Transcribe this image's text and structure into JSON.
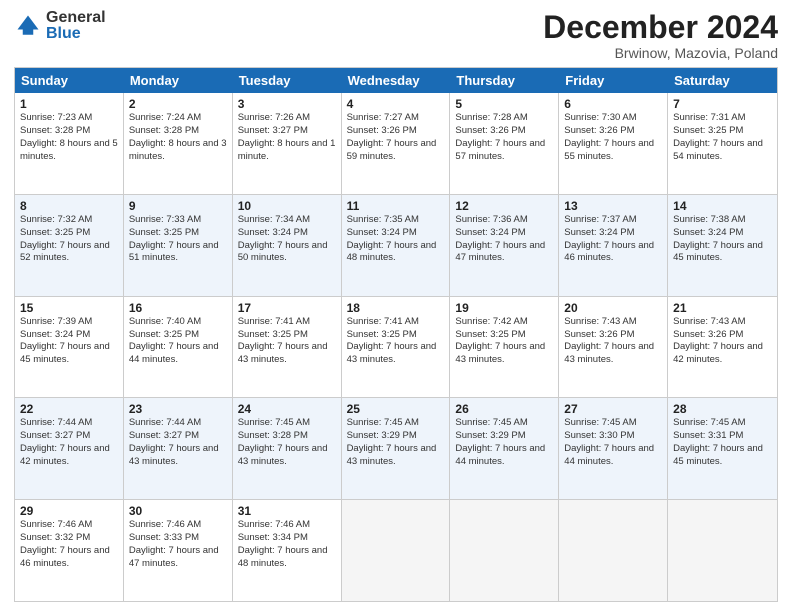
{
  "logo": {
    "general": "General",
    "blue": "Blue"
  },
  "title": "December 2024",
  "subtitle": "Brwinow, Mazovia, Poland",
  "days": [
    "Sunday",
    "Monday",
    "Tuesday",
    "Wednesday",
    "Thursday",
    "Friday",
    "Saturday"
  ],
  "rows": [
    {
      "alt": false,
      "cells": [
        {
          "day": "1",
          "info": "Sunrise: 7:23 AM\nSunset: 3:28 PM\nDaylight: 8 hours and 5 minutes."
        },
        {
          "day": "2",
          "info": "Sunrise: 7:24 AM\nSunset: 3:28 PM\nDaylight: 8 hours and 3 minutes."
        },
        {
          "day": "3",
          "info": "Sunrise: 7:26 AM\nSunset: 3:27 PM\nDaylight: 8 hours and 1 minute."
        },
        {
          "day": "4",
          "info": "Sunrise: 7:27 AM\nSunset: 3:26 PM\nDaylight: 7 hours and 59 minutes."
        },
        {
          "day": "5",
          "info": "Sunrise: 7:28 AM\nSunset: 3:26 PM\nDaylight: 7 hours and 57 minutes."
        },
        {
          "day": "6",
          "info": "Sunrise: 7:30 AM\nSunset: 3:26 PM\nDaylight: 7 hours and 55 minutes."
        },
        {
          "day": "7",
          "info": "Sunrise: 7:31 AM\nSunset: 3:25 PM\nDaylight: 7 hours and 54 minutes."
        }
      ]
    },
    {
      "alt": true,
      "cells": [
        {
          "day": "8",
          "info": "Sunrise: 7:32 AM\nSunset: 3:25 PM\nDaylight: 7 hours and 52 minutes."
        },
        {
          "day": "9",
          "info": "Sunrise: 7:33 AM\nSunset: 3:25 PM\nDaylight: 7 hours and 51 minutes."
        },
        {
          "day": "10",
          "info": "Sunrise: 7:34 AM\nSunset: 3:24 PM\nDaylight: 7 hours and 50 minutes."
        },
        {
          "day": "11",
          "info": "Sunrise: 7:35 AM\nSunset: 3:24 PM\nDaylight: 7 hours and 48 minutes."
        },
        {
          "day": "12",
          "info": "Sunrise: 7:36 AM\nSunset: 3:24 PM\nDaylight: 7 hours and 47 minutes."
        },
        {
          "day": "13",
          "info": "Sunrise: 7:37 AM\nSunset: 3:24 PM\nDaylight: 7 hours and 46 minutes."
        },
        {
          "day": "14",
          "info": "Sunrise: 7:38 AM\nSunset: 3:24 PM\nDaylight: 7 hours and 45 minutes."
        }
      ]
    },
    {
      "alt": false,
      "cells": [
        {
          "day": "15",
          "info": "Sunrise: 7:39 AM\nSunset: 3:24 PM\nDaylight: 7 hours and 45 minutes."
        },
        {
          "day": "16",
          "info": "Sunrise: 7:40 AM\nSunset: 3:25 PM\nDaylight: 7 hours and 44 minutes."
        },
        {
          "day": "17",
          "info": "Sunrise: 7:41 AM\nSunset: 3:25 PM\nDaylight: 7 hours and 43 minutes."
        },
        {
          "day": "18",
          "info": "Sunrise: 7:41 AM\nSunset: 3:25 PM\nDaylight: 7 hours and 43 minutes."
        },
        {
          "day": "19",
          "info": "Sunrise: 7:42 AM\nSunset: 3:25 PM\nDaylight: 7 hours and 43 minutes."
        },
        {
          "day": "20",
          "info": "Sunrise: 7:43 AM\nSunset: 3:26 PM\nDaylight: 7 hours and 43 minutes."
        },
        {
          "day": "21",
          "info": "Sunrise: 7:43 AM\nSunset: 3:26 PM\nDaylight: 7 hours and 42 minutes."
        }
      ]
    },
    {
      "alt": true,
      "cells": [
        {
          "day": "22",
          "info": "Sunrise: 7:44 AM\nSunset: 3:27 PM\nDaylight: 7 hours and 42 minutes."
        },
        {
          "day": "23",
          "info": "Sunrise: 7:44 AM\nSunset: 3:27 PM\nDaylight: 7 hours and 43 minutes."
        },
        {
          "day": "24",
          "info": "Sunrise: 7:45 AM\nSunset: 3:28 PM\nDaylight: 7 hours and 43 minutes."
        },
        {
          "day": "25",
          "info": "Sunrise: 7:45 AM\nSunset: 3:29 PM\nDaylight: 7 hours and 43 minutes."
        },
        {
          "day": "26",
          "info": "Sunrise: 7:45 AM\nSunset: 3:29 PM\nDaylight: 7 hours and 44 minutes."
        },
        {
          "day": "27",
          "info": "Sunrise: 7:45 AM\nSunset: 3:30 PM\nDaylight: 7 hours and 44 minutes."
        },
        {
          "day": "28",
          "info": "Sunrise: 7:45 AM\nSunset: 3:31 PM\nDaylight: 7 hours and 45 minutes."
        }
      ]
    },
    {
      "alt": false,
      "cells": [
        {
          "day": "29",
          "info": "Sunrise: 7:46 AM\nSunset: 3:32 PM\nDaylight: 7 hours and 46 minutes."
        },
        {
          "day": "30",
          "info": "Sunrise: 7:46 AM\nSunset: 3:33 PM\nDaylight: 7 hours and 47 minutes."
        },
        {
          "day": "31",
          "info": "Sunrise: 7:46 AM\nSunset: 3:34 PM\nDaylight: 7 hours and 48 minutes."
        },
        {
          "day": "",
          "info": ""
        },
        {
          "day": "",
          "info": ""
        },
        {
          "day": "",
          "info": ""
        },
        {
          "day": "",
          "info": ""
        }
      ]
    }
  ]
}
